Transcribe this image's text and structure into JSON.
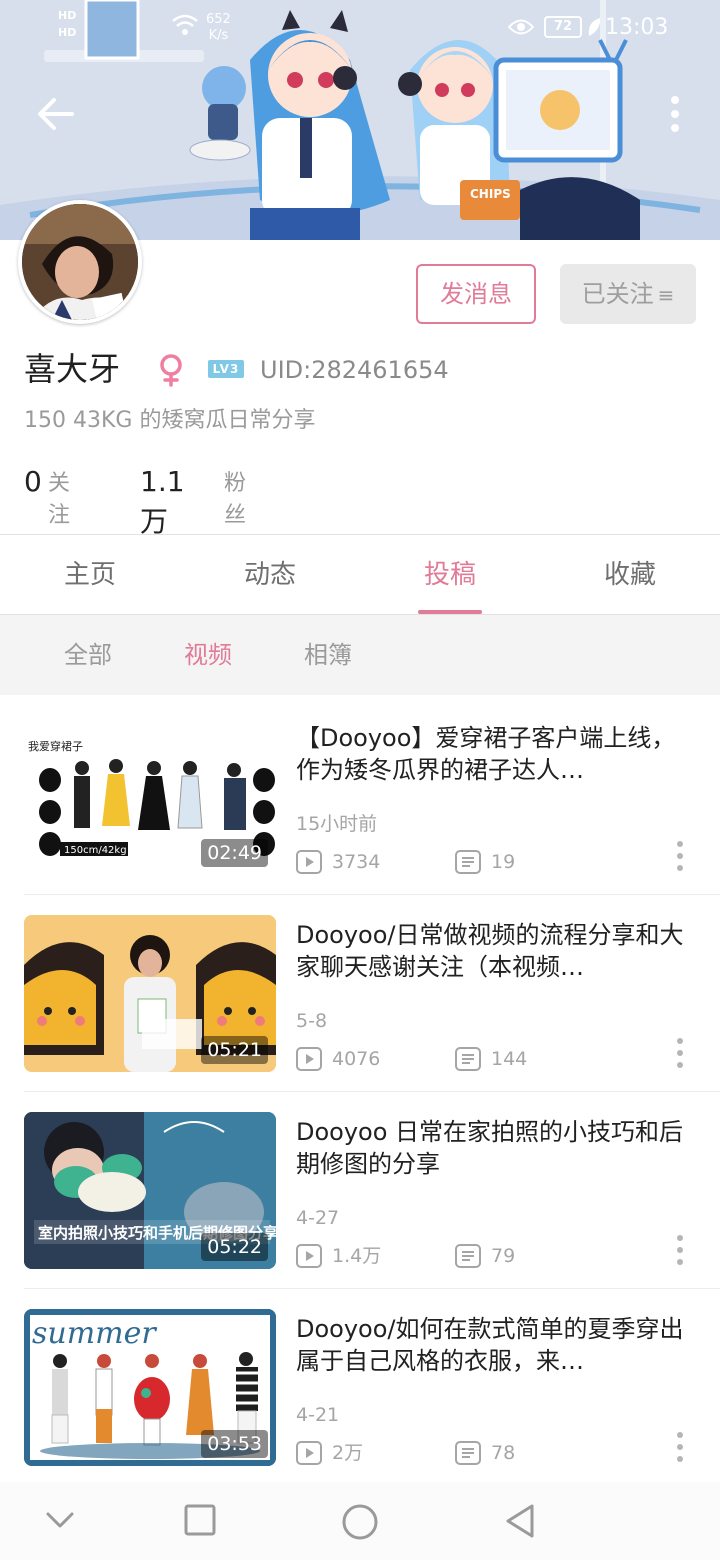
{
  "status_bar": {
    "signal_label_1": "HD",
    "signal_label_2": "HD",
    "net_speed_value": "652",
    "net_speed_unit": "K/s",
    "battery": "72",
    "time": "13:03"
  },
  "banner": {
    "back_icon": "arrow-left-icon",
    "more_icon": "more-vertical-icon",
    "chips_label": "CHIPS"
  },
  "profile": {
    "name": "喜大牙",
    "gender_icon": "female-icon",
    "level": "LV3",
    "uid": "UID:282461654",
    "bio": "150 43KG 的矮窝瓜日常分享",
    "following_count": "0",
    "following_label": "关注",
    "fans_count": "1.1万",
    "fans_label": "粉丝",
    "message_button": "发消息",
    "followed_button": "已关注",
    "followed_menu_glyph": "≡"
  },
  "tabs": [
    {
      "label": "主页",
      "active": false
    },
    {
      "label": "动态",
      "active": false
    },
    {
      "label": "投稿",
      "active": true
    },
    {
      "label": "收藏",
      "active": false
    }
  ],
  "subtabs": [
    {
      "label": "全部",
      "active": false
    },
    {
      "label": "视频",
      "active": true
    },
    {
      "label": "相簿",
      "active": false
    }
  ],
  "videos": [
    {
      "title": "【Dooyoo】爱穿裙子客户端上线，作为矮冬瓜界的裙子达人…",
      "date": "15小时前",
      "plays": "3734",
      "comments": "19",
      "duration": "02:49",
      "thumb_text": "我爱穿裙子",
      "thumb_caption": "150cm/42kg",
      "accent": "#ffffff"
    },
    {
      "title": "Dooyoo/日常做视频的流程分享和大家聊天感谢关注（本视频…",
      "date": "5-8",
      "plays": "4076",
      "comments": "144",
      "duration": "05:21",
      "thumb_text": "",
      "thumb_caption": "",
      "accent": "#f7c97a"
    },
    {
      "title": "Dooyoo 日常在家拍照的小技巧和后期修图的分享",
      "date": "4-27",
      "plays": "1.4万",
      "comments": "79",
      "duration": "05:22",
      "thumb_text": "室内拍照小技巧和手机后期修图分享",
      "thumb_caption": "",
      "accent": "#3d7fa0"
    },
    {
      "title": "Dooyoo/如何在款式简单的夏季穿出属于自己风格的衣服，来…",
      "date": "4-21",
      "plays": "2万",
      "comments": "78",
      "duration": "03:53",
      "thumb_text": "summer",
      "thumb_caption": "",
      "accent": "#2f6b93"
    }
  ],
  "icons": {
    "play": "play-count-icon",
    "comment": "comment-count-icon",
    "more": "more-vertical-icon",
    "nav_back": "nav-back-icon",
    "nav_home": "nav-home-icon",
    "nav_recents": "nav-recents-icon",
    "nav_collapse": "nav-collapse-icon"
  },
  "colors": {
    "accent_pink": "#e07b98",
    "text_primary": "#212121",
    "text_secondary": "#9a9a9a",
    "followed_bg": "#e9e9e9",
    "level_badge": "#7fc8e6"
  }
}
